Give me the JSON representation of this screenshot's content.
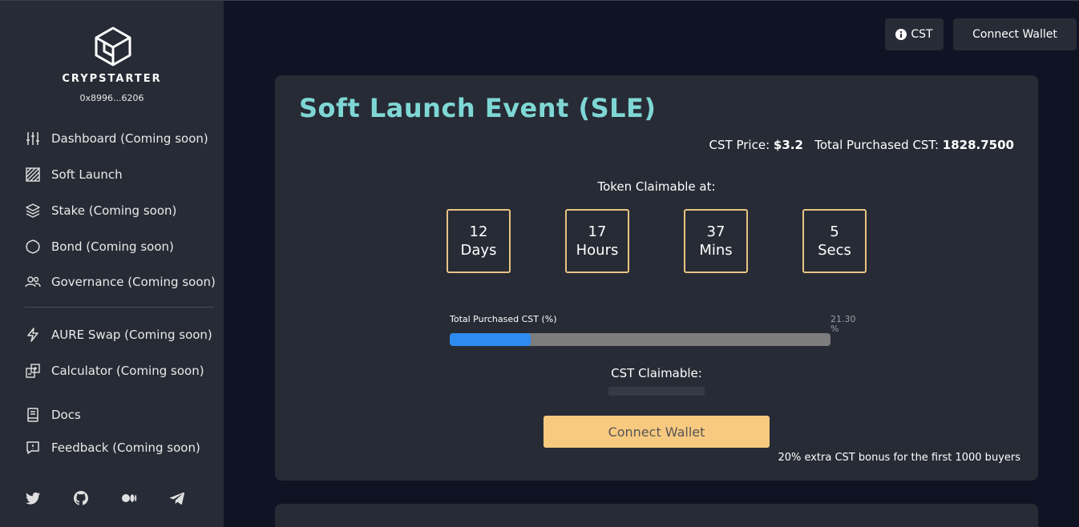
{
  "sidebar": {
    "brand": "CRYPSTARTER",
    "address": "0x8996...6206",
    "items": [
      {
        "label": "Dashboard (Coming soon)",
        "icon": "sliders-icon"
      },
      {
        "label": "Soft Launch",
        "icon": "hatched-square-icon"
      },
      {
        "label": "Stake (Coming soon)",
        "icon": "layers-icon"
      },
      {
        "label": "Bond (Coming soon)",
        "icon": "gear-ring-icon"
      },
      {
        "label": "Governance (Coming soon)",
        "icon": "users-icon"
      },
      {
        "label": "AURE Swap (Coming soon)",
        "icon": "lightning-icon"
      },
      {
        "label": "Calculator (Coming soon)",
        "icon": "calculator-icon"
      },
      {
        "label": "Docs",
        "icon": "book-icon"
      },
      {
        "label": "Feedback (Coming soon)",
        "icon": "feedback-icon"
      }
    ],
    "socials": [
      "twitter-icon",
      "github-icon",
      "medium-icon",
      "telegram-icon"
    ]
  },
  "header": {
    "cst_label": "CST",
    "wallet_label": "Connect Wallet"
  },
  "sle": {
    "title": "Soft Launch Event (SLE)",
    "price_label": "CST Price:",
    "price_value": "$3.2",
    "total_label": "Total Purchased CST:",
    "total_value": "1828.7500",
    "claimable_at_label": "Token Claimable at:",
    "countdown": [
      {
        "value": "12",
        "unit": "Days"
      },
      {
        "value": "17",
        "unit": "Hours"
      },
      {
        "value": "37",
        "unit": "Mins"
      },
      {
        "value": "5",
        "unit": "Secs"
      }
    ],
    "progress_label": "Total Purchased CST (%)",
    "progress_percent_text": "21.30",
    "progress_percent_unit": "%",
    "progress_value": 21.3,
    "claimable_label": "CST Claimable:",
    "connect_label": "Connect Wallet",
    "bonus_text": "20% extra CST bonus for the first 1000 buyers"
  },
  "colors": {
    "accent_title": "#7fd7d5",
    "timer_border": "#e8c482",
    "progress_fill": "#2d8cf0",
    "connect_button": "#f8ca80"
  }
}
